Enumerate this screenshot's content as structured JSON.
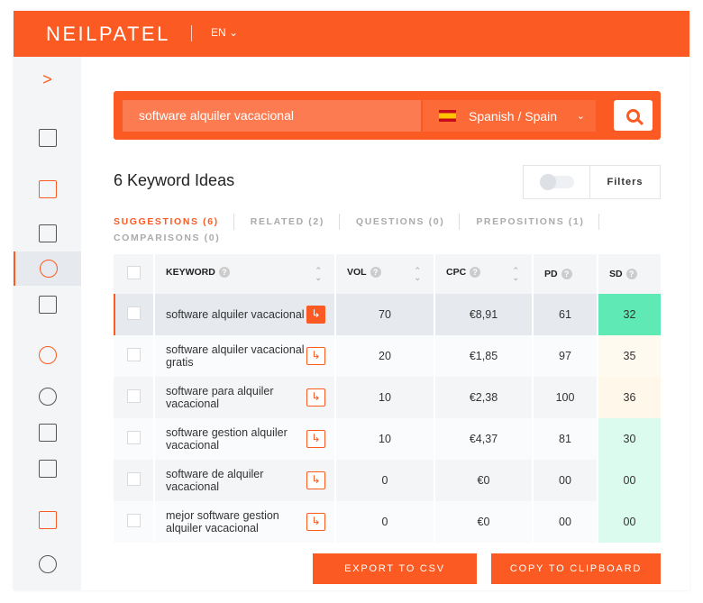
{
  "header": {
    "logo": "NEILPATEL",
    "language": "EN"
  },
  "sidebar": {
    "toggle": ">",
    "items": [
      "dashboard",
      "site-audit",
      "traffic-analyzer",
      "keyword-ideas",
      "content-ideas",
      "backlinks",
      "rank-tracking",
      "reports",
      "keyword-list",
      "traffic-monitor",
      "settings"
    ],
    "active": "keyword-ideas"
  },
  "search": {
    "value": "software alquiler vacacional",
    "language": "Spanish / Spain"
  },
  "main": {
    "title": "6 Keyword Ideas",
    "filters_label": "Filters",
    "tabs": [
      {
        "label": "SUGGESTIONS (6)",
        "active": true
      },
      {
        "label": "RELATED (2)"
      },
      {
        "label": "QUESTIONS (0)"
      },
      {
        "label": "PREPOSITIONS (1)"
      },
      {
        "label": "COMPARISONS (0)"
      }
    ]
  },
  "table": {
    "headers": [
      "KEYWORD",
      "VOL",
      "CPC",
      "PD",
      "SD"
    ],
    "rows": [
      {
        "keyword": "software alquiler vacacional",
        "vol": "70",
        "cpc": "€8,91",
        "pd": "61",
        "sd": "32",
        "sd_color": "#5ee9b5"
      },
      {
        "keyword": "software alquiler vacacional gratis",
        "vol": "20",
        "cpc": "€1,85",
        "pd": "97",
        "sd": "35",
        "sd_color": "#fffaf0"
      },
      {
        "keyword": "software para alquiler vacacional",
        "vol": "10",
        "cpc": "€2,38",
        "pd": "100",
        "sd": "36",
        "sd_color": "#fff8ea"
      },
      {
        "keyword": "software gestion alquiler vacacional",
        "vol": "10",
        "cpc": "€4,37",
        "pd": "81",
        "sd": "30",
        "sd_color": "#dcfbef"
      },
      {
        "keyword": "software de alquiler vacacional",
        "vol": "0",
        "cpc": "€0",
        "pd": "00",
        "sd": "00",
        "sd_color": "#dcfbef"
      },
      {
        "keyword": "mejor software gestion alquiler vacacional",
        "vol": "0",
        "cpc": "€0",
        "pd": "00",
        "sd": "00",
        "sd_color": "#dcfbef"
      }
    ]
  },
  "actions": {
    "export": "EXPORT TO CSV",
    "copy": "COPY TO CLIPBOARD"
  },
  "colors": {
    "brand": "#fb5a22"
  }
}
